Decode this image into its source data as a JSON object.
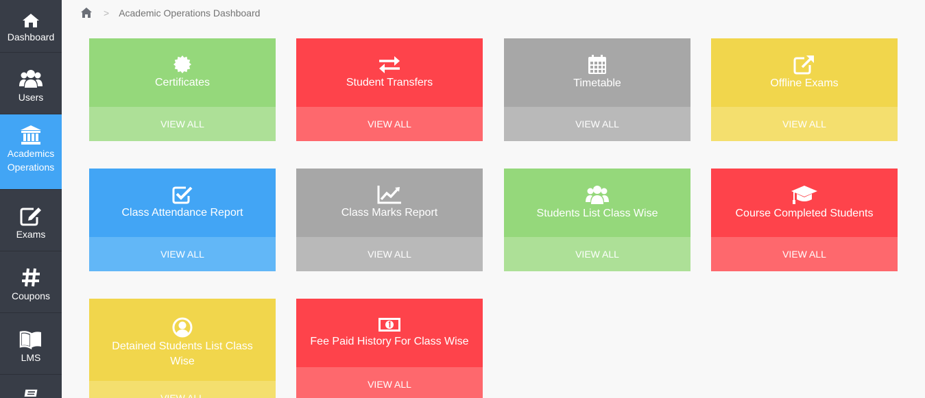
{
  "sidebar": {
    "items": [
      {
        "label": "Dashboard",
        "icon": "home-icon"
      },
      {
        "label": "Users",
        "icon": "users-icon"
      },
      {
        "label": "Academics\nOperations",
        "icon": "institution-icon"
      },
      {
        "label": "Exams",
        "icon": "edit-icon"
      },
      {
        "label": "Coupons",
        "icon": "hashtag-icon"
      },
      {
        "label": "LMS",
        "icon": "book-icon"
      },
      {
        "label": "",
        "icon": "ticket-icon"
      }
    ]
  },
  "breadcrumb": {
    "home_icon": "home-icon",
    "separator": ">",
    "current": "Academic Operations Dashboard"
  },
  "cards": [
    {
      "title": "Certificates",
      "button": "VIEW ALL",
      "icon": "certificate-icon",
      "color": "green"
    },
    {
      "title": "Student Transfers",
      "button": "VIEW ALL",
      "icon": "exchange-icon",
      "color": "red"
    },
    {
      "title": "Timetable",
      "button": "VIEW ALL",
      "icon": "calendar-icon",
      "color": "gray"
    },
    {
      "title": "Offline Exams",
      "button": "VIEW ALL",
      "icon": "external-link-icon",
      "color": "yellow"
    },
    {
      "title": "Class Attendance Report",
      "button": "VIEW ALL",
      "icon": "check-square-icon",
      "color": "blue"
    },
    {
      "title": "Class Marks Report",
      "button": "VIEW ALL",
      "icon": "line-chart-icon",
      "color": "gray"
    },
    {
      "title": "Students List Class Wise",
      "button": "VIEW ALL",
      "icon": "users-icon",
      "color": "green"
    },
    {
      "title": "Course Completed Students",
      "button": "VIEW ALL",
      "icon": "graduation-cap-icon",
      "color": "red"
    },
    {
      "title": "Detained Students List Class Wise",
      "button": "VIEW ALL",
      "icon": "user-circle-icon",
      "color": "yellow"
    },
    {
      "title": "Fee Paid History For Class Wise",
      "button": "VIEW ALL",
      "icon": "money-icon",
      "color": "red"
    }
  ],
  "colors": {
    "sidebar_bg": "#383d47",
    "active": "#42a5f5",
    "green": "#95d87b",
    "red": "#fe434b",
    "gray": "#a7a7a7",
    "yellow": "#f1d64c",
    "blue": "#42a5f5"
  }
}
